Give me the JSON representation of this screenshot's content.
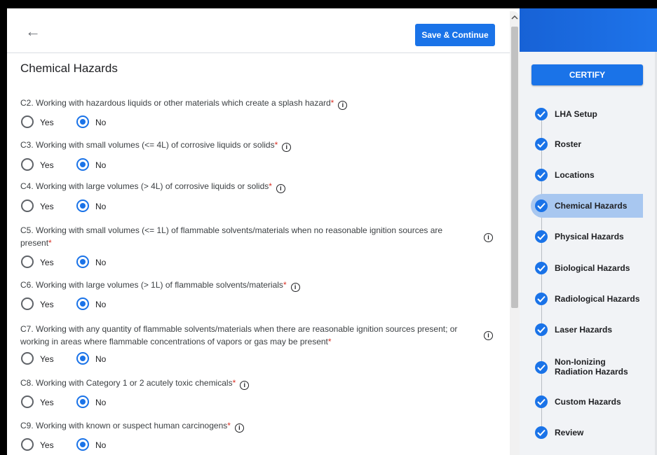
{
  "header": {
    "back_label": "←",
    "save_label": "Save & Continue"
  },
  "section_title": "Chemical Hazards",
  "options": {
    "yes": "Yes",
    "no": "No"
  },
  "questions": [
    {
      "text": "C2. Working with hazardous liquids or other materials which create a splash hazard",
      "answer": "No"
    },
    {
      "text": "C3. Working with small volumes (<= 4L) of corrosive liquids or solids",
      "answer": "No"
    },
    {
      "text": "C4. Working with large volumes (> 4L) of corrosive liquids or solids",
      "answer": "No"
    },
    {
      "text": "C5. Working with small volumes (<= 1L) of flammable solvents/materials when no reasonable ignition sources are present",
      "answer": "No"
    },
    {
      "text": "C6. Working with large volumes (> 1L) of flammable solvents/materials",
      "answer": "No"
    },
    {
      "text": "C7. Working with any quantity of flammable solvents/materials when there are reasonable ignition sources present; or working in areas where flammable concentrations of vapors or gas may be present",
      "answer": "No"
    },
    {
      "text": "C8. Working with Category 1 or 2 acutely toxic chemicals",
      "answer": "No"
    },
    {
      "text": "C9. Working with known or suspect human carcinogens",
      "answer": "No"
    }
  ],
  "required_mark": "*",
  "info_glyph": "i",
  "sidebar": {
    "certify_label": "CERTIFY",
    "steps": [
      {
        "label": "LHA Setup"
      },
      {
        "label": "Roster"
      },
      {
        "label": "Locations"
      },
      {
        "label": "Chemical Hazards",
        "active": true
      },
      {
        "label": "Physical Hazards"
      },
      {
        "label": "Biological Hazards"
      },
      {
        "label": "Radiological Hazards"
      },
      {
        "label": "Laser Hazards"
      },
      {
        "label": "Non-Ionizing Radiation Hazards"
      },
      {
        "label": "Custom Hazards"
      },
      {
        "label": "Review"
      }
    ]
  },
  "colors": {
    "accent": "#1a73e8",
    "topbar": "#1a6fe0",
    "active_step": "#a8c7f0",
    "required": "#d93025"
  }
}
